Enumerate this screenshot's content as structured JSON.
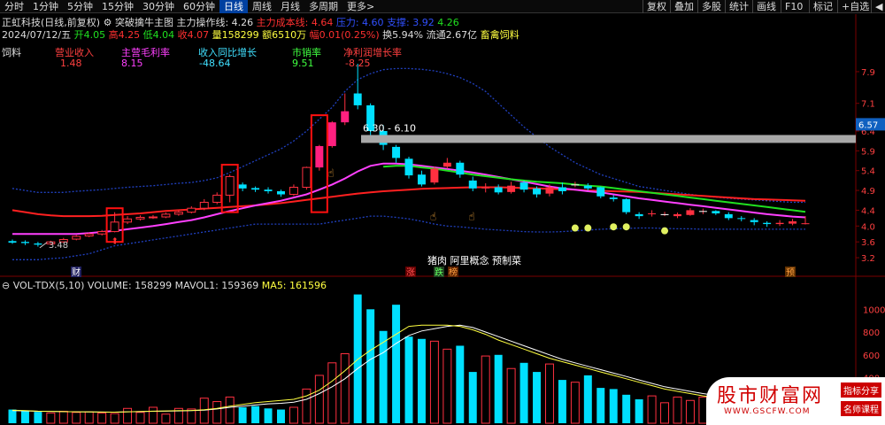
{
  "toolbar": {
    "tabs": [
      "分时",
      "1分钟",
      "5分钟",
      "15分钟",
      "30分钟",
      "60分钟",
      "日线",
      "周线",
      "月线",
      "多周期",
      "更多>"
    ],
    "active_tab": "日线",
    "right_buttons": [
      "复权",
      "叠加",
      "多股",
      "统计",
      "画线",
      "F10",
      "标记",
      "+自选",
      "◀"
    ]
  },
  "header": {
    "stock_name": "正虹科技(日线,前复权)",
    "indicator_name": "突破擒牛主图",
    "main_line_label": "主力操作线: 4.26",
    "cost_line_label": "主力成本线: 4.64",
    "pressure_label": "压力: 4.60",
    "support_label": "支撑: 3.92",
    "value_label": "4.26"
  },
  "quote": {
    "date": "2024/07/12/五",
    "open": "开4.05",
    "high": "高4.25",
    "low": "低4.04",
    "close": "收4.07",
    "volume": "量158299",
    "amount": "额6510万",
    "change": "幅0.01(0.25%)",
    "turnover": "换5.94%",
    "float_cap": "流通2.67亿",
    "industry": "畜禽饲料"
  },
  "fin": {
    "category": "饲料",
    "items": [
      {
        "label": "营业收入",
        "value": "1.48",
        "label_color": "#ff4040",
        "value_color": "#ff4040"
      },
      {
        "label": "主营毛利率",
        "value": "8.15",
        "label_color": "#ff40ff",
        "value_color": "#ff40ff"
      },
      {
        "label": "收入同比增长",
        "value": "-48.64",
        "label_color": "#40e0ff",
        "value_color": "#40e0ff"
      },
      {
        "label": "市销率",
        "value": "9.51",
        "label_color": "#40ff40",
        "value_color": "#40ff40"
      },
      {
        "label": "净利润增长率",
        "value": "-8.25",
        "label_color": "#ff4040",
        "value_color": "#ff4040"
      }
    ]
  },
  "chart_labels": {
    "resistance_band": "6.30 - 6.10",
    "low_marker": "3.48",
    "concepts": "猪肉 阿里概念 预制菜",
    "tag_cai": "财",
    "tag_zhang": "涨",
    "tag_die": "跌",
    "tag_bang": "榜",
    "tag_yu": "预"
  },
  "price_axis": [
    "7.9",
    "7.1",
    "6.4",
    "5.9",
    "5.4",
    "4.9",
    "4.4",
    "4.0",
    "3.6",
    "3.2"
  ],
  "current_price_tag": "6.57",
  "volume_header": {
    "name": "VOL-TDX(5,10)",
    "volume": "VOLUME: 158299",
    "mavol1": "MAVOL1: 159369",
    "ma5": "MA5: 161596"
  },
  "volume_axis": [
    "1000",
    "800",
    "600",
    "400",
    "200"
  ],
  "watermark": {
    "title": "股市财富网",
    "url": "WWW.GSCFW.COM",
    "badge1": "指标分享",
    "badge2": "名师课程"
  },
  "colors": {
    "up": "#ff3040",
    "down": "#00e0ff",
    "ma_pink": "#ff40ff",
    "ma_green": "#20e020",
    "ma_red": "#ff2020",
    "band": "#2040c0"
  },
  "chart_data": {
    "type": "candlestick",
    "price_ylim": [
      3.0,
      8.1
    ],
    "candles": [
      {
        "o": 3.62,
        "c": 3.58,
        "h": 3.66,
        "l": 3.55
      },
      {
        "o": 3.6,
        "c": 3.57,
        "h": 3.64,
        "l": 3.52
      },
      {
        "o": 3.56,
        "c": 3.53,
        "h": 3.6,
        "l": 3.48
      },
      {
        "o": 3.55,
        "c": 3.6,
        "h": 3.63,
        "l": 3.52
      },
      {
        "o": 3.6,
        "c": 3.66,
        "h": 3.7,
        "l": 3.58
      },
      {
        "o": 3.67,
        "c": 3.74,
        "h": 3.77,
        "l": 3.64
      },
      {
        "o": 3.75,
        "c": 3.8,
        "h": 3.83,
        "l": 3.72
      },
      {
        "o": 3.8,
        "c": 3.86,
        "h": 3.9,
        "l": 3.76
      },
      {
        "o": 3.86,
        "c": 4.1,
        "h": 4.35,
        "l": 3.84
      },
      {
        "o": 4.1,
        "c": 4.18,
        "h": 4.25,
        "l": 4.05
      },
      {
        "o": 4.18,
        "c": 4.22,
        "h": 4.27,
        "l": 4.14
      },
      {
        "o": 4.22,
        "c": 4.23,
        "h": 4.28,
        "l": 4.18
      },
      {
        "o": 4.23,
        "c": 4.3,
        "h": 4.34,
        "l": 4.2
      },
      {
        "o": 4.3,
        "c": 4.35,
        "h": 4.4,
        "l": 4.26
      },
      {
        "o": 4.35,
        "c": 4.45,
        "h": 4.5,
        "l": 4.32
      },
      {
        "o": 4.45,
        "c": 4.6,
        "h": 4.68,
        "l": 4.4
      },
      {
        "o": 4.6,
        "c": 4.78,
        "h": 4.85,
        "l": 4.55
      },
      {
        "o": 4.78,
        "c": 5.25,
        "h": 5.3,
        "l": 4.6
      },
      {
        "o": 5.05,
        "c": 4.95,
        "h": 5.1,
        "l": 4.88
      },
      {
        "o": 4.96,
        "c": 4.92,
        "h": 5.0,
        "l": 4.86
      },
      {
        "o": 4.92,
        "c": 4.88,
        "h": 4.98,
        "l": 4.82
      },
      {
        "o": 4.88,
        "c": 4.8,
        "h": 4.92,
        "l": 4.74
      },
      {
        "o": 4.8,
        "c": 4.98,
        "h": 5.05,
        "l": 4.76
      },
      {
        "o": 4.98,
        "c": 5.48,
        "h": 5.5,
        "l": 4.92
      },
      {
        "o": 5.48,
        "c": 6.02,
        "h": 6.05,
        "l": 5.4
      },
      {
        "o": 6.02,
        "c": 6.62,
        "h": 6.65,
        "l": 5.98
      },
      {
        "o": 6.62,
        "c": 6.9,
        "h": 7.35,
        "l": 6.55
      },
      {
        "o": 7.35,
        "c": 7.05,
        "h": 8.1,
        "l": 6.95
      },
      {
        "o": 7.05,
        "c": 6.4,
        "h": 7.1,
        "l": 6.2
      },
      {
        "o": 6.4,
        "c": 6.05,
        "h": 6.55,
        "l": 5.92
      },
      {
        "o": 6.0,
        "c": 5.72,
        "h": 6.05,
        "l": 5.6
      },
      {
        "o": 5.7,
        "c": 5.28,
        "h": 5.75,
        "l": 5.2
      },
      {
        "o": 5.3,
        "c": 5.05,
        "h": 5.4,
        "l": 5.0
      },
      {
        "o": 5.1,
        "c": 5.45,
        "h": 5.5,
        "l": 5.05
      },
      {
        "o": 5.5,
        "c": 5.6,
        "h": 5.72,
        "l": 5.45
      },
      {
        "o": 5.6,
        "c": 5.3,
        "h": 5.65,
        "l": 5.22
      },
      {
        "o": 5.15,
        "c": 4.95,
        "h": 5.25,
        "l": 4.88
      },
      {
        "o": 4.95,
        "c": 4.98,
        "h": 5.08,
        "l": 4.85
      },
      {
        "o": 4.98,
        "c": 4.85,
        "h": 5.05,
        "l": 4.8
      },
      {
        "o": 4.86,
        "c": 5.02,
        "h": 5.12,
        "l": 4.82
      },
      {
        "o": 5.1,
        "c": 4.92,
        "h": 5.15,
        "l": 4.85
      },
      {
        "o": 4.95,
        "c": 4.8,
        "h": 5.0,
        "l": 4.72
      },
      {
        "o": 4.82,
        "c": 4.98,
        "h": 5.05,
        "l": 4.75
      },
      {
        "o": 4.98,
        "c": 4.88,
        "h": 5.1,
        "l": 4.8
      },
      {
        "o": 5.05,
        "c": 5.05,
        "h": 5.12,
        "l": 4.98
      },
      {
        "o": 5.02,
        "c": 4.95,
        "h": 5.08,
        "l": 4.9
      },
      {
        "o": 4.98,
        "c": 4.75,
        "h": 5.0,
        "l": 4.7
      },
      {
        "o": 4.72,
        "c": 4.68,
        "h": 4.78,
        "l": 4.62
      },
      {
        "o": 4.68,
        "c": 4.35,
        "h": 4.7,
        "l": 4.3
      },
      {
        "o": 4.3,
        "c": 4.25,
        "h": 4.35,
        "l": 4.18
      },
      {
        "o": 4.3,
        "c": 4.32,
        "h": 4.4,
        "l": 4.24
      },
      {
        "o": 4.3,
        "c": 4.3,
        "h": 4.36,
        "l": 4.25
      },
      {
        "o": 4.25,
        "c": 4.3,
        "h": 4.34,
        "l": 4.2
      },
      {
        "o": 4.28,
        "c": 4.4,
        "h": 4.45,
        "l": 4.26
      },
      {
        "o": 4.38,
        "c": 4.38,
        "h": 4.44,
        "l": 4.3
      },
      {
        "o": 4.38,
        "c": 4.32,
        "h": 4.4,
        "l": 4.28
      },
      {
        "o": 4.3,
        "c": 4.2,
        "h": 4.35,
        "l": 4.15
      },
      {
        "o": 4.2,
        "c": 4.18,
        "h": 4.25,
        "l": 4.12
      },
      {
        "o": 4.15,
        "c": 4.1,
        "h": 4.2,
        "l": 4.02
      },
      {
        "o": 4.08,
        "c": 4.05,
        "h": 4.12,
        "l": 3.98
      },
      {
        "o": 4.05,
        "c": 4.08,
        "h": 4.15,
        "l": 4.0
      },
      {
        "o": 4.06,
        "c": 4.12,
        "h": 4.18,
        "l": 4.02
      },
      {
        "o": 4.05,
        "c": 4.07,
        "h": 4.25,
        "l": 4.04
      }
    ],
    "ma_line": [
      3.8,
      3.8,
      3.8,
      3.8,
      3.8,
      3.8,
      3.82,
      3.85,
      3.88,
      3.92,
      3.96,
      4.0,
      4.05,
      4.1,
      4.15,
      4.22,
      4.3,
      4.38,
      4.45,
      4.52,
      4.58,
      4.64,
      4.72,
      4.8,
      4.92,
      5.05,
      5.2,
      5.38,
      5.52,
      5.58,
      5.58,
      5.56,
      5.52,
      5.48,
      5.44,
      5.4,
      5.35,
      5.3,
      5.24,
      5.18,
      5.12,
      5.06,
      5.0,
      4.95,
      4.92,
      4.88,
      4.85,
      4.8,
      4.75,
      4.7,
      4.66,
      4.62,
      4.58,
      4.54,
      4.5,
      4.46,
      4.42,
      4.38,
      4.34,
      4.3,
      4.27,
      4.24,
      4.22
    ],
    "cost_line": [
      4.4,
      4.35,
      4.3,
      4.27,
      4.25,
      4.25,
      4.25,
      4.26,
      4.28,
      4.3,
      4.32,
      4.35,
      4.38,
      4.4,
      4.42,
      4.44,
      4.46,
      4.48,
      4.5,
      4.52,
      4.55,
      4.58,
      4.62,
      4.66,
      4.7,
      4.74,
      4.78,
      4.82,
      4.85,
      4.88,
      4.9,
      4.92,
      4.94,
      4.95,
      4.96,
      4.97,
      4.98,
      4.98,
      4.98,
      4.97,
      4.96,
      4.95,
      4.94,
      4.93,
      4.92,
      4.9,
      4.89,
      4.88,
      4.87,
      4.86,
      4.84,
      4.82,
      4.8,
      4.78,
      4.76,
      4.74,
      4.72,
      4.7,
      4.68,
      4.67,
      4.66,
      4.65,
      4.64
    ],
    "band_upper": [
      4.95,
      4.9,
      4.85,
      4.85,
      4.85,
      4.88,
      4.9,
      4.92,
      4.95,
      4.98,
      5.0,
      5.02,
      5.05,
      5.08,
      5.1,
      5.15,
      5.22,
      5.35,
      5.5,
      5.65,
      5.8,
      5.95,
      6.15,
      6.4,
      6.7,
      7.0,
      7.4,
      7.7,
      7.85,
      7.95,
      7.98,
      7.98,
      7.96,
      7.92,
      7.85,
      7.75,
      7.6,
      7.4,
      7.1,
      6.8,
      6.5,
      6.25,
      6.0,
      5.8,
      5.6,
      5.45,
      5.3,
      5.2,
      5.1,
      5.0,
      4.95,
      4.9,
      4.85,
      4.8,
      4.76,
      4.73,
      4.7,
      4.68,
      4.66,
      4.64,
      4.62,
      4.6,
      4.6
    ],
    "band_lower": [
      3.15,
      3.15,
      3.15,
      3.18,
      3.2,
      3.25,
      3.3,
      3.4,
      3.5,
      3.55,
      3.6,
      3.65,
      3.7,
      3.75,
      3.8,
      3.85,
      3.9,
      3.95,
      4.0,
      4.05,
      4.05,
      4.05,
      4.05,
      4.05,
      4.05,
      4.1,
      4.15,
      4.2,
      4.25,
      4.25,
      4.22,
      4.18,
      4.12,
      4.05,
      4.0,
      3.98,
      3.95,
      3.92,
      3.9,
      3.88,
      3.86,
      3.85,
      3.85,
      3.86,
      3.88,
      3.9,
      3.92,
      3.93,
      3.94,
      3.95,
      3.95,
      3.94,
      3.93,
      3.93,
      3.92,
      3.92,
      3.92,
      3.92,
      3.92,
      3.92,
      3.92,
      3.92,
      3.92
    ],
    "green_line_start": 29,
    "green_line": [
      5.5,
      5.52,
      5.52,
      5.48,
      5.45,
      5.4,
      5.35,
      5.3,
      5.26,
      5.22,
      5.18,
      5.15,
      5.12,
      5.1,
      5.08,
      5.05,
      5.02,
      5.0,
      4.96,
      4.92,
      4.88,
      4.84,
      4.8,
      4.76,
      4.72,
      4.68,
      4.64,
      4.6,
      4.56,
      4.52,
      4.48,
      4.44,
      4.4,
      4.36
    ],
    "volume_ylim": [
      0,
      1150
    ],
    "volumes": [
      120,
      110,
      100,
      90,
      105,
      95,
      100,
      90,
      85,
      130,
      95,
      140,
      80,
      130,
      125,
      220,
      190,
      230,
      140,
      150,
      130,
      120,
      140,
      300,
      420,
      530,
      610,
      1130,
      1000,
      810,
      1040,
      760,
      740,
      720,
      650,
      680,
      450,
      590,
      600,
      480,
      530,
      450,
      520,
      380,
      360,
      420,
      310,
      300,
      250,
      210,
      240,
      180,
      230,
      200,
      230,
      170,
      160,
      170,
      140,
      130,
      150,
      140,
      158
    ],
    "mavol1": [
      110,
      108,
      105,
      104,
      102,
      100,
      99,
      98,
      97,
      100,
      102,
      105,
      106,
      108,
      110,
      115,
      125,
      140,
      150,
      160,
      170,
      175,
      185,
      210,
      260,
      320,
      390,
      480,
      560,
      620,
      700,
      770,
      810,
      830,
      850,
      860,
      840,
      800,
      760,
      720,
      680,
      640,
      600,
      560,
      530,
      500,
      470,
      440,
      410,
      380,
      350,
      320,
      300,
      280,
      260,
      245,
      232,
      218,
      205,
      192,
      180,
      170,
      160
    ],
    "ma5_vol": [
      115,
      110,
      106,
      104,
      102,
      100,
      100,
      98,
      97,
      100,
      103,
      106,
      108,
      110,
      112,
      118,
      130,
      150,
      165,
      180,
      190,
      200,
      210,
      240,
      290,
      370,
      460,
      560,
      640,
      710,
      780,
      850,
      860,
      860,
      860,
      850,
      820,
      780,
      730,
      690,
      650,
      610,
      570,
      540,
      510,
      480,
      450,
      420,
      390,
      360,
      330,
      300,
      280,
      260,
      240,
      225,
      210,
      198,
      186,
      175,
      165,
      160,
      162
    ]
  }
}
